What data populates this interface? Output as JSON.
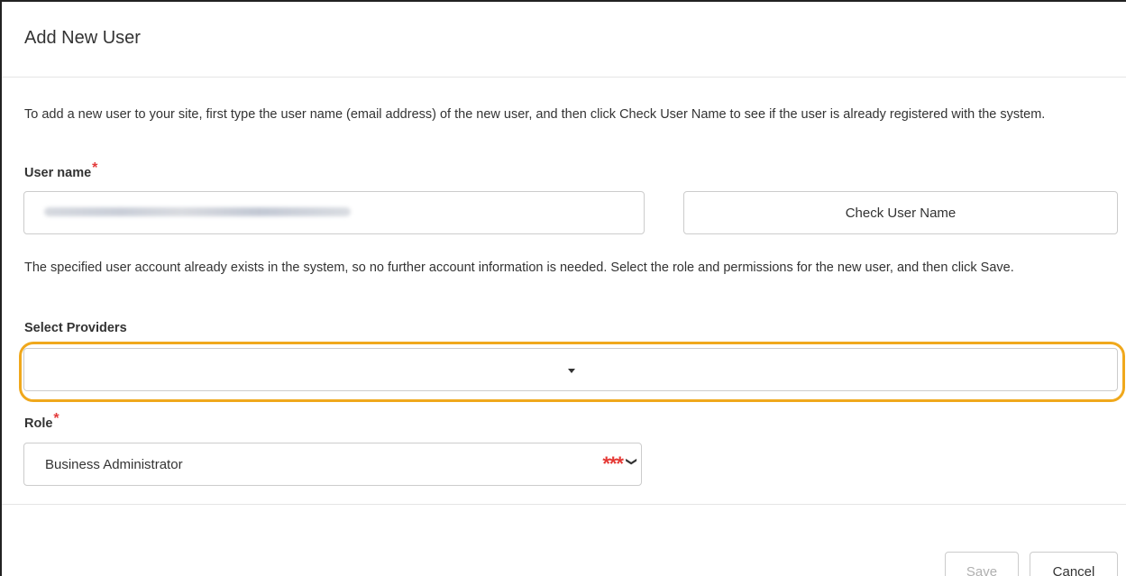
{
  "dialog": {
    "title": "Add New User",
    "intro_text": "To add a new user to your site, first type the user name (email address) of the new user, and then click Check User Name to see if the user is already registered with the system.",
    "username": {
      "label": "User name",
      "required_marker": "*",
      "value_obscured": true
    },
    "check_button_label": "Check User Name",
    "exists_message": "The specified user account already exists in the system, so no further account information is needed. Select the role and permissions for the new user, and then click Save.",
    "providers": {
      "label": "Select Providers",
      "value": ""
    },
    "role": {
      "label": "Role",
      "required_marker": "*",
      "value": "Business Administrator",
      "marker": "***"
    },
    "footer": {
      "save_label": "Save",
      "cancel_label": "Cancel"
    }
  },
  "colors": {
    "required_star": "#e33b3b",
    "highlight_border": "#f0a81c",
    "input_border": "#cccccc"
  }
}
